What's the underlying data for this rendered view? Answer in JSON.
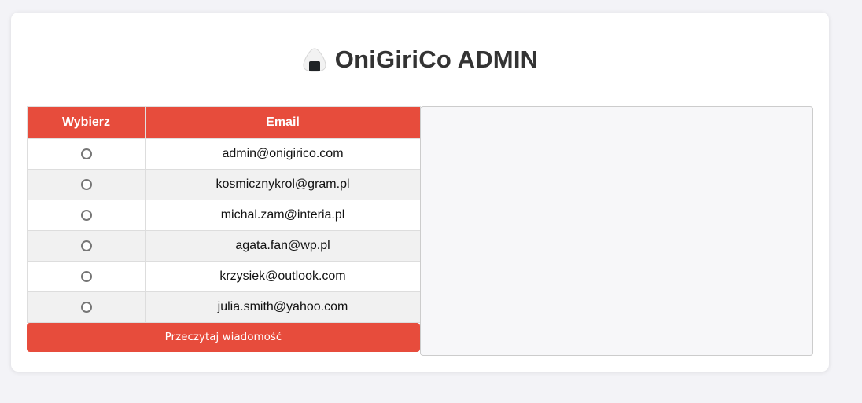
{
  "header": {
    "title": "OniGiriCo ADMIN",
    "logo_icon": "onigiri-icon"
  },
  "table": {
    "columns": [
      "Wybierz",
      "Email"
    ],
    "rows": [
      {
        "email": "admin@onigirico.com",
        "selected": false
      },
      {
        "email": "kosmicznykrol@gram.pl",
        "selected": false
      },
      {
        "email": "michal.zam@interia.pl",
        "selected": false
      },
      {
        "email": "agata.fan@wp.pl",
        "selected": false
      },
      {
        "email": "krzysiek@outlook.com",
        "selected": false
      },
      {
        "email": "julia.smith@yahoo.com",
        "selected": false
      }
    ]
  },
  "actions": {
    "read_label": "Przeczytaj wiadomość"
  },
  "colors": {
    "accent": "#e74c3c",
    "background": "#f3f3f7"
  }
}
